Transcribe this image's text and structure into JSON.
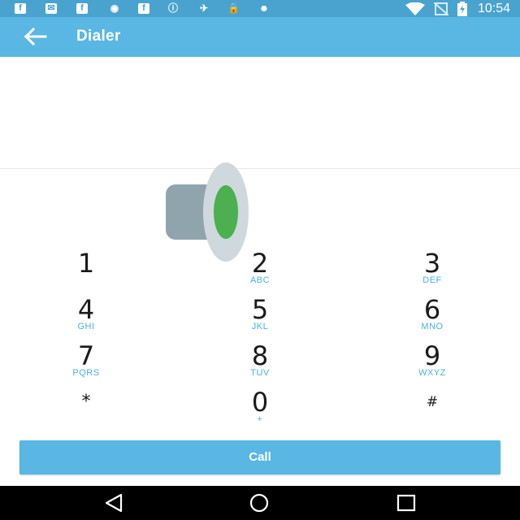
{
  "status_bar": {
    "time": "10:54",
    "left_icons": [
      "facebook-icon",
      "email-icon",
      "facebook-icon",
      "eye-icon",
      "facebook-icon",
      "info-icon",
      "satellite-icon",
      "lock-icon",
      "android-icon"
    ],
    "right_icons": [
      "wifi-icon",
      "no-sim-icon",
      "battery-charging-icon"
    ]
  },
  "toolbar": {
    "title": "Dialer",
    "back_icon": "arrow-left-icon"
  },
  "display": {
    "number": ""
  },
  "keypad": {
    "keys": [
      {
        "digit": "1",
        "letters": ""
      },
      {
        "digit": "2",
        "letters": "ABC"
      },
      {
        "digit": "3",
        "letters": "DEF"
      },
      {
        "digit": "4",
        "letters": "GHI"
      },
      {
        "digit": "5",
        "letters": "JKL"
      },
      {
        "digit": "6",
        "letters": "MNO"
      },
      {
        "digit": "7",
        "letters": "PQRS"
      },
      {
        "digit": "8",
        "letters": "TUV"
      },
      {
        "digit": "9",
        "letters": "WXYZ"
      },
      {
        "digit": "*",
        "letters": ""
      },
      {
        "digit": "0",
        "letters": "+"
      },
      {
        "digit": "#",
        "letters": ""
      }
    ]
  },
  "call_button": {
    "label": "Call"
  },
  "nav_bar": {
    "icons": [
      "back-triangle-icon",
      "home-circle-icon",
      "recents-square-icon"
    ]
  },
  "colors": {
    "primary": "#5ab6e3",
    "status_bar": "#4aa3cf",
    "accent_text": "#4ab0dd",
    "speaker_green": "#4caf50"
  }
}
